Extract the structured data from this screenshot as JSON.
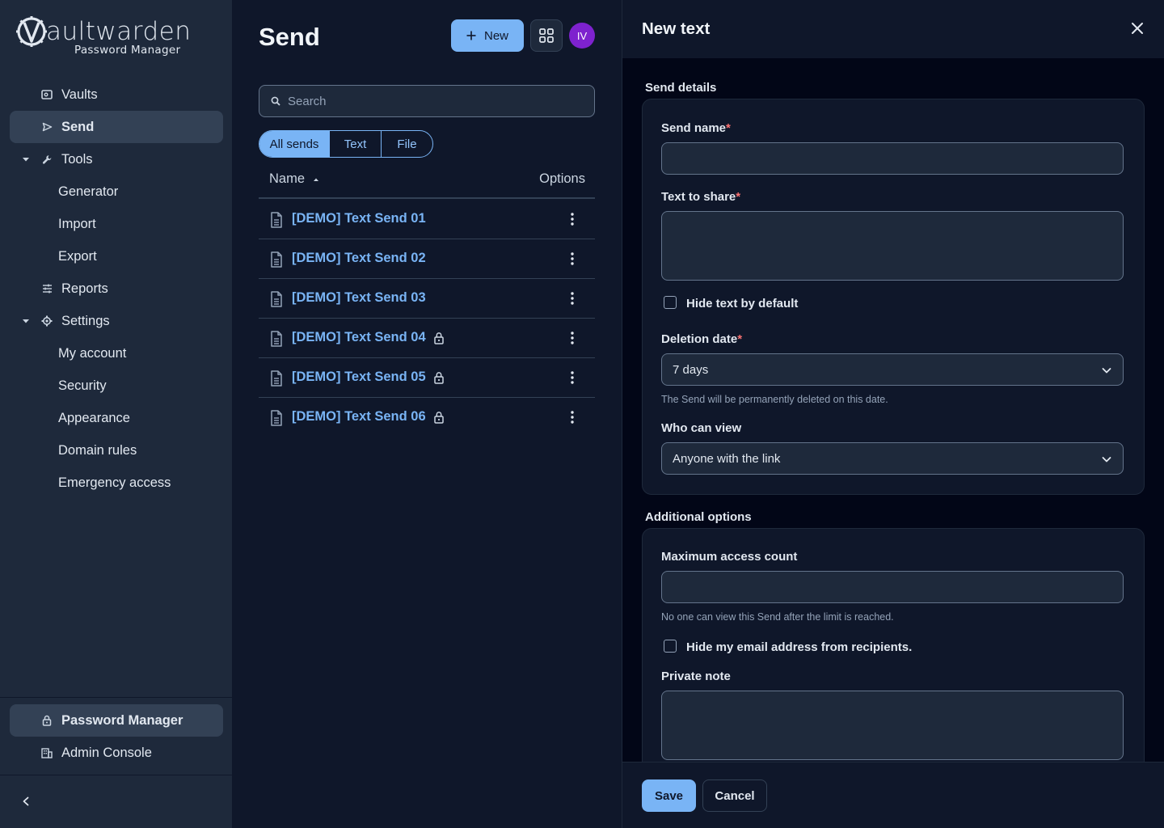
{
  "brand": {
    "wordmark": "aultwarden",
    "subtitle": "Password Manager"
  },
  "sidebar": {
    "items": [
      {
        "label": "Vaults",
        "icon": "vault-icon"
      },
      {
        "label": "Send",
        "icon": "send-icon"
      },
      {
        "label": "Tools",
        "icon": "wrench-icon"
      },
      {
        "label": "Generator"
      },
      {
        "label": "Import"
      },
      {
        "label": "Export"
      },
      {
        "label": "Reports",
        "icon": "sliders-icon"
      },
      {
        "label": "Settings",
        "icon": "gear-icon"
      },
      {
        "label": "My account"
      },
      {
        "label": "Security"
      },
      {
        "label": "Appearance"
      },
      {
        "label": "Domain rules"
      },
      {
        "label": "Emergency access"
      }
    ],
    "active": "Send",
    "bottom": [
      {
        "label": "Password Manager",
        "icon": "lock-icon"
      },
      {
        "label": "Admin Console",
        "icon": "building-icon"
      }
    ]
  },
  "send": {
    "title": "Send",
    "new_label": "New",
    "avatar_initials": "IV",
    "search_placeholder": "Search",
    "filters": [
      "All sends",
      "Text",
      "File"
    ],
    "active_filter": "All sends",
    "columns": {
      "name": "Name",
      "options": "Options"
    },
    "rows": [
      {
        "name": "[DEMO] Text Send 01",
        "locked": false
      },
      {
        "name": "[DEMO] Text Send 02",
        "locked": false
      },
      {
        "name": "[DEMO] Text Send 03",
        "locked": false
      },
      {
        "name": "[DEMO] Text Send 04",
        "locked": true
      },
      {
        "name": "[DEMO] Text Send 05",
        "locked": true
      },
      {
        "name": "[DEMO] Text Send 06",
        "locked": true
      }
    ]
  },
  "drawer": {
    "title": "New text",
    "send_details_label": "Send details",
    "send_name_label": "Send name",
    "text_to_share_label": "Text to share",
    "hide_text_label": "Hide text by default",
    "deletion_date_label": "Deletion date",
    "deletion_date_value": "7 days",
    "deletion_hint": "The Send will be permanently deleted on this date.",
    "who_can_view_label": "Who can view",
    "who_can_view_value": "Anyone with the link",
    "additional_options_label": "Additional options",
    "max_access_label": "Maximum access count",
    "max_access_hint": "No one can view this Send after the limit is reached.",
    "hide_email_label": "Hide my email address from recipients.",
    "private_note_label": "Private note",
    "required_mark": "*",
    "save_label": "Save",
    "cancel_label": "Cancel"
  },
  "colors": {
    "accent": "#79b4f5",
    "avatar": "#7e22ce",
    "required": "#f87171"
  }
}
